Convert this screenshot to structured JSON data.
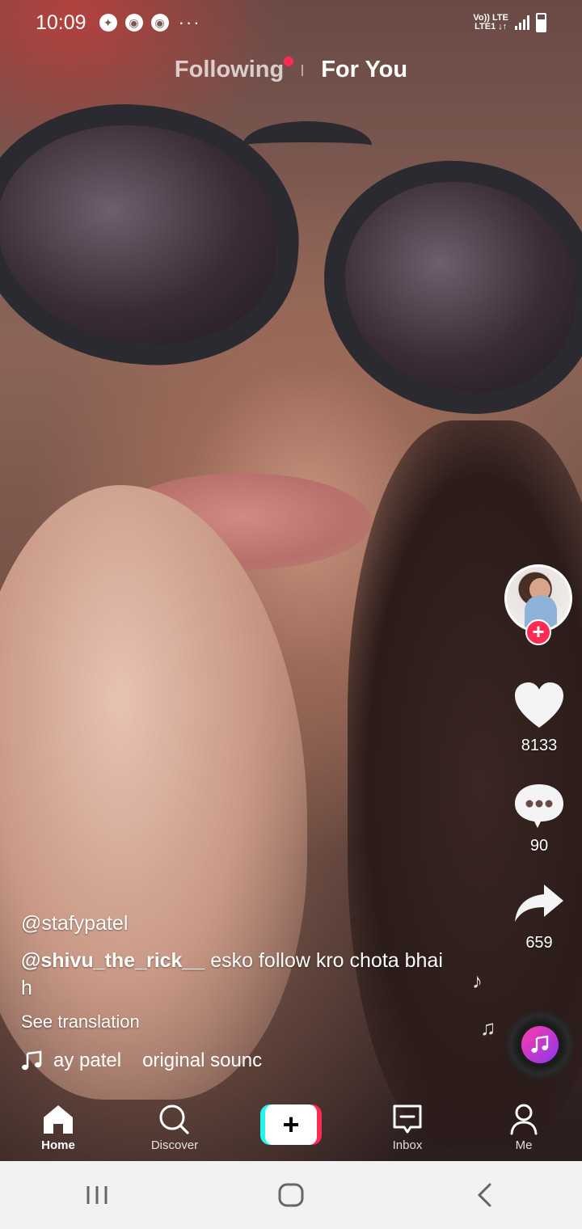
{
  "status_bar": {
    "time": "10:09",
    "network_label_top": "Vo)) LTE",
    "network_label_bottom": "LTE1 ↓↑",
    "notification_icons": [
      "camera-shutter-icon",
      "chrome-icon",
      "chrome-icon"
    ],
    "more": "···"
  },
  "top_tabs": {
    "following": "Following",
    "for_you": "For You",
    "active": "For You"
  },
  "actions": {
    "like_count": "8133",
    "comment_count": "90",
    "share_count": "659"
  },
  "caption": {
    "author": "@stafypatel",
    "mention": "@shivu_the_rick__",
    "text": " esko follow kro chota bhai h",
    "see_translation": "See translation"
  },
  "sound": {
    "artist": "ay patel",
    "title": "original sounc"
  },
  "bottom_nav": {
    "home": "Home",
    "discover": "Discover",
    "create": "+",
    "inbox": "Inbox",
    "me": "Me"
  },
  "colors": {
    "accent_red": "#fe2c55",
    "accent_cyan": "#25f4ee",
    "music_gradient_start": "#ff3ca8",
    "music_gradient_end": "#8a36f2"
  }
}
